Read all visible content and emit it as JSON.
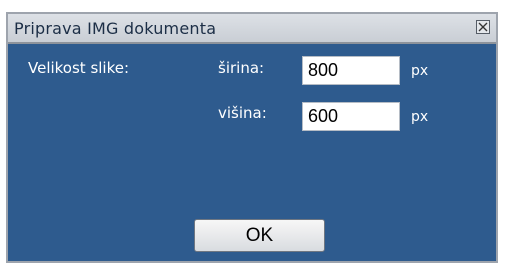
{
  "dialog": {
    "title": "Priprava IMG dokumenta",
    "close_icon": "close-icon",
    "size_label": "Velikost slike:",
    "width_label": "širina:",
    "width_value": "800",
    "width_unit": "px",
    "height_label": "višina:",
    "height_value": "600",
    "height_unit": "px",
    "ok_label": "OK"
  },
  "colors": {
    "panel": "#2e5b8e",
    "titlebar": "#d3d7dd",
    "label_text": "#ffffff"
  }
}
